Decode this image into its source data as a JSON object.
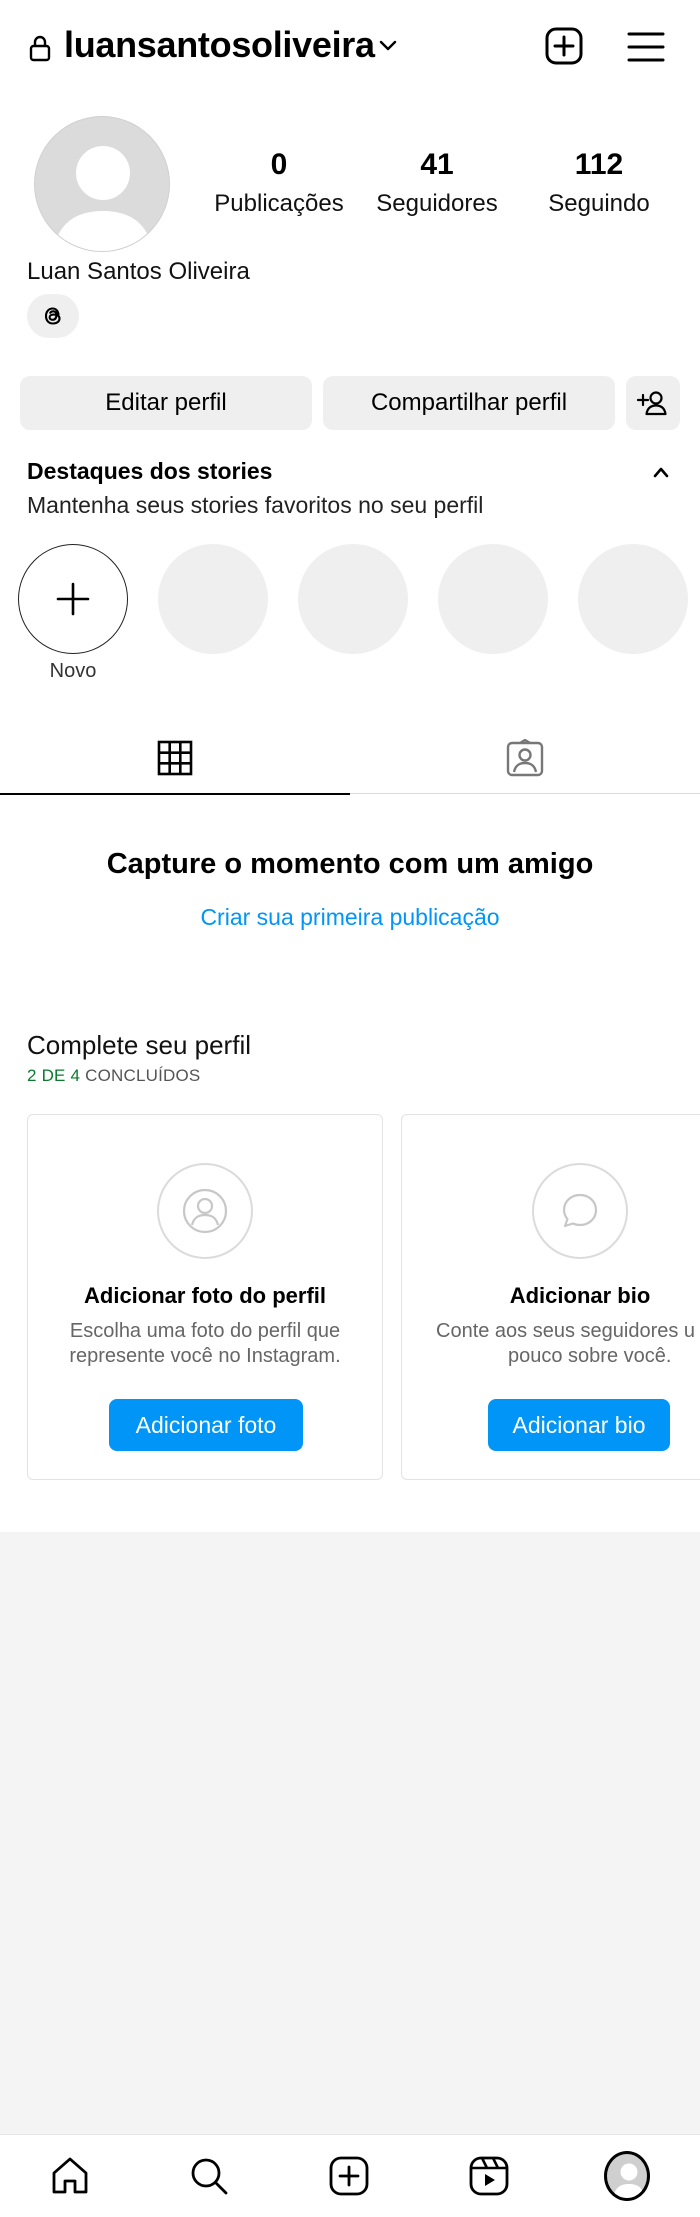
{
  "header": {
    "username": "luansantosoliveira",
    "lock_icon": "lock-icon",
    "chevron_icon": "chevron-down-icon",
    "create_icon": "plus-square-icon",
    "menu_icon": "hamburger-menu-icon"
  },
  "profile": {
    "full_name": "Luan Santos Oliveira",
    "stats": [
      {
        "value": "0",
        "label": "Publicações"
      },
      {
        "value": "41",
        "label": "Seguidores"
      },
      {
        "value": "112",
        "label": "Seguindo"
      }
    ]
  },
  "actions": {
    "edit_label": "Editar perfil",
    "share_label": "Compartilhar perfil"
  },
  "highlights": {
    "title": "Destaques dos stories",
    "subtitle": "Mantenha seus stories favoritos no seu perfil",
    "new_label": "Novo"
  },
  "empty_state": {
    "title": "Capture o momento com um amigo",
    "link": "Criar sua primeira publicação"
  },
  "complete_profile": {
    "title": "Complete seu perfil",
    "progress_done": "2 DE 4",
    "progress_suffix": " CONCLUÍDOS",
    "cards": [
      {
        "title": "Adicionar foto do perfil",
        "text_line1": "Escolha uma foto do perfil que",
        "text_line2": "represente você no Instagram.",
        "button": "Adicionar foto"
      },
      {
        "title": "Adicionar bio",
        "text_line1": "Conte aos seus seguidores u",
        "text_line2": "pouco sobre você.",
        "button": "Adicionar bio"
      }
    ]
  },
  "colors": {
    "accent": "#0095f6",
    "progress_green": "#0a7a2e",
    "chip_bg": "#efefef",
    "page_bg": "#f4f4f4"
  }
}
